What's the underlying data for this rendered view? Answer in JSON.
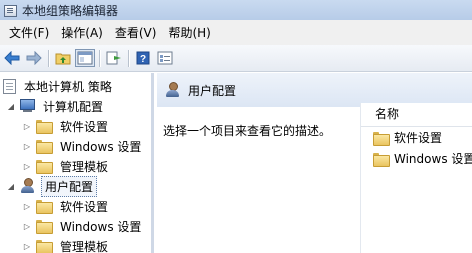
{
  "window": {
    "title": "本地组策略编辑器"
  },
  "menu": [
    "文件(F)",
    "操作(A)",
    "查看(V)",
    "帮助(H)"
  ],
  "toolbar": {
    "buttons": [
      "back-icon",
      "forward-icon",
      "up-folder-icon",
      "show-hide-tree-icon",
      "export-list-icon",
      "help-icon",
      "properties-icon"
    ]
  },
  "tree": {
    "root": "本地计算机 策略",
    "computer_config": {
      "label": "计算机配置",
      "children": [
        "软件设置",
        "Windows 设置",
        "管理模板"
      ]
    },
    "user_config": {
      "label": "用户配置",
      "children": [
        "软件设置",
        "Windows 设置",
        "管理模板"
      ]
    }
  },
  "content": {
    "header_title": "用户配置",
    "description": "选择一个项目来查看它的描述。",
    "list": {
      "column_header": "名称",
      "items": [
        "软件设置",
        "Windows 设置"
      ]
    }
  },
  "colors": {
    "titlebar": "#c9daf0",
    "selection_border": "#5f7ea8",
    "folder": "#e9c460"
  }
}
